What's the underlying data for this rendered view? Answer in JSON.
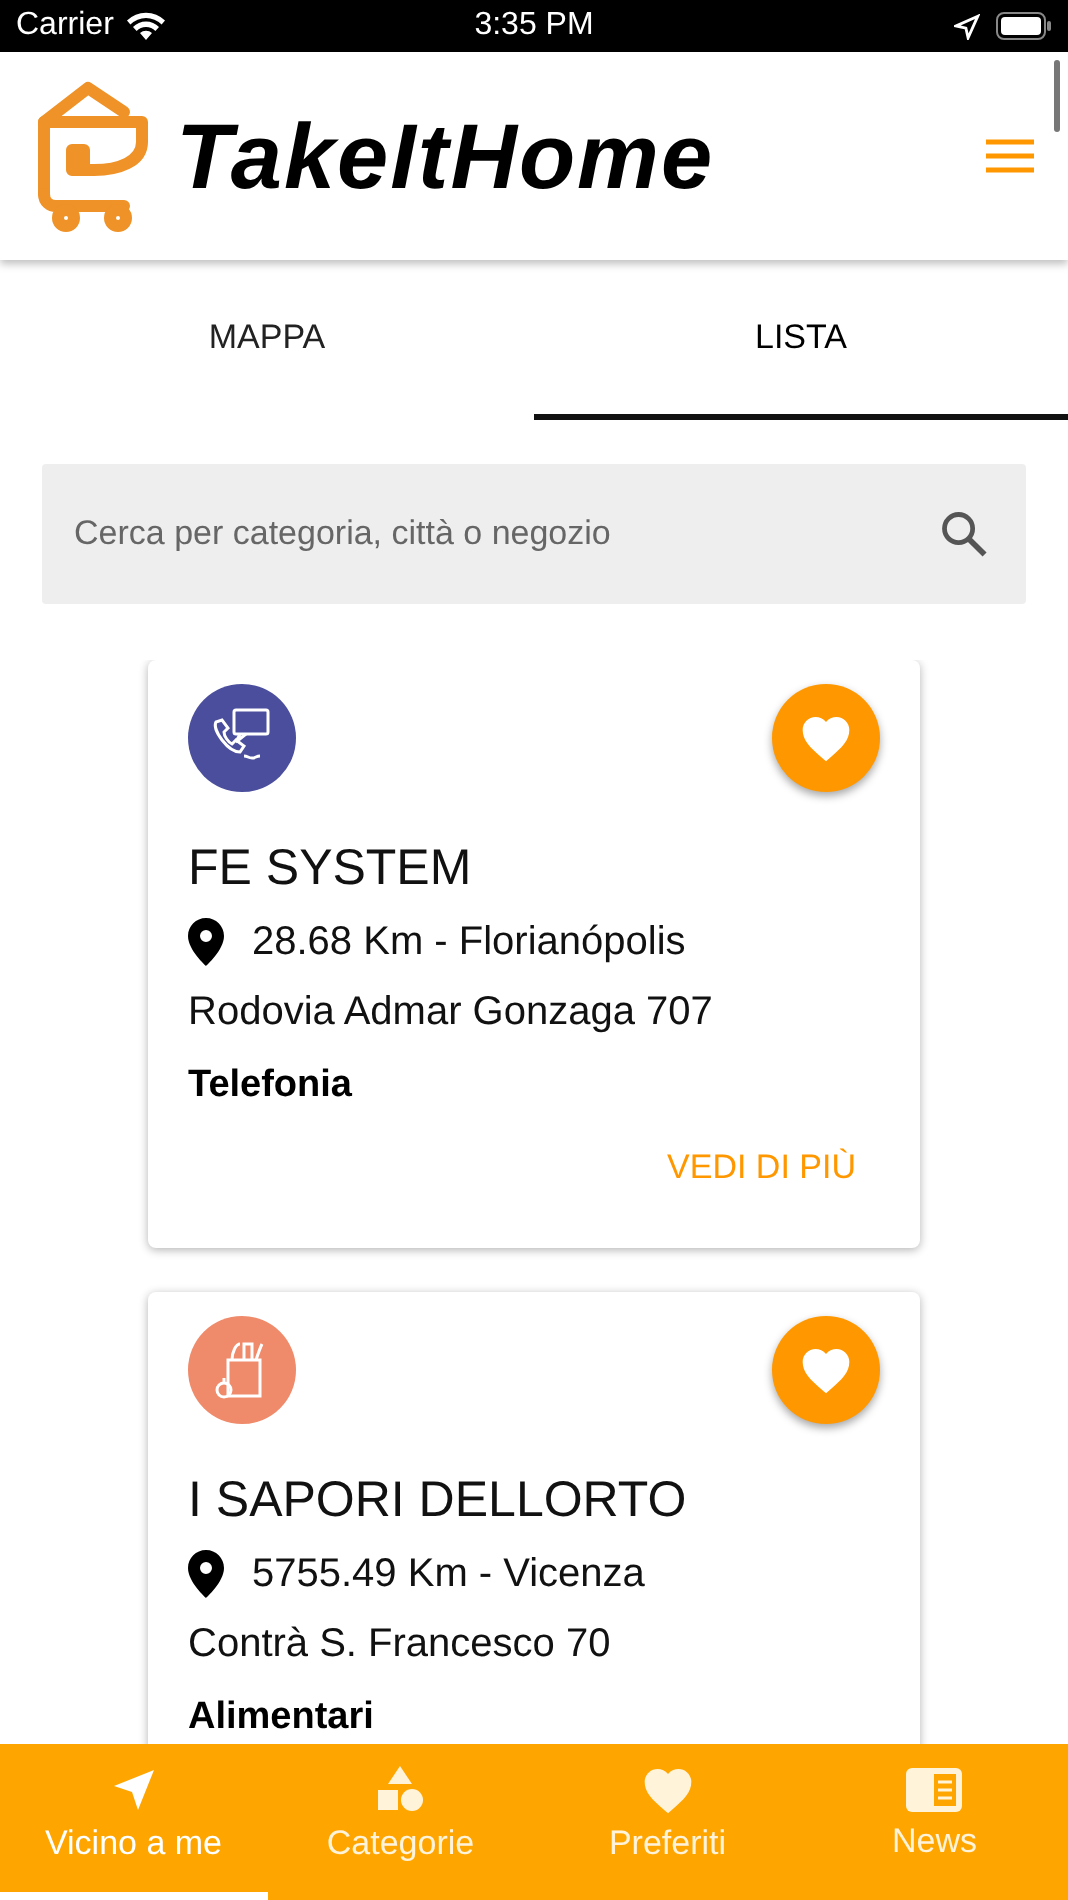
{
  "status_bar": {
    "carrier": "Carrier",
    "time": "3:35 PM"
  },
  "header": {
    "title": "TakeItHome"
  },
  "tabs": [
    {
      "label": "MAPPA",
      "selected": false
    },
    {
      "label": "LISTA",
      "selected": true
    }
  ],
  "search": {
    "placeholder": "Cerca per categoria, città o negozio"
  },
  "shops": [
    {
      "kind": "phone",
      "color": "#4a4e9c",
      "name": "FE SYSTEM",
      "distance": "28.68 Km - Florianópolis",
      "address": "Rodovia Admar Gonzaga 707",
      "category": "Telefonia",
      "action": "VEDI DI PIÙ"
    },
    {
      "kind": "grocery",
      "color": "#ef8a6a",
      "name": "I SAPORI DELLORTO",
      "distance": "5755.49 Km - Vicenza",
      "address": "Contrà S. Francesco 70",
      "category": "Alimentari"
    }
  ],
  "bottom_nav": [
    {
      "kind": "nearby",
      "label": "Vicino a me",
      "selected": true
    },
    {
      "kind": "categories",
      "label": "Categorie",
      "selected": false
    },
    {
      "kind": "favorites",
      "label": "Preferiti",
      "selected": false
    },
    {
      "kind": "news",
      "label": "News",
      "selected": false
    }
  ]
}
